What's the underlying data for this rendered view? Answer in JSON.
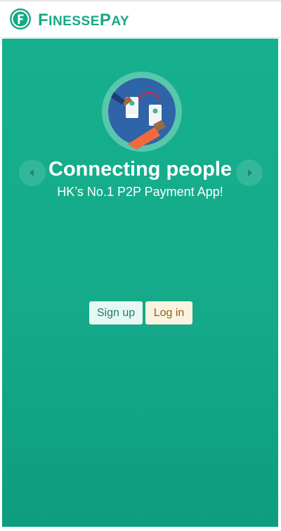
{
  "header": {
    "brand_first": "F",
    "brand_rest_1": "INESSE",
    "brand_mid": "P",
    "brand_rest_2": "AY",
    "logo_icon": "finessepay-logo-icon"
  },
  "carousel": {
    "title": "Connecting people",
    "subtitle": "HK’s No.1 P2P Payment App!",
    "illustration_icon": "phones-exchange-illustration",
    "prev_icon": "chevron-left-icon",
    "next_icon": "chevron-right-icon"
  },
  "actions": {
    "signup_label": "Sign up",
    "login_label": "Log in"
  },
  "colors": {
    "brand": "#17a887",
    "hero_bg": "#14aa8a",
    "signup_bg": "#e7f8f4",
    "login_bg": "#fbf3df"
  }
}
